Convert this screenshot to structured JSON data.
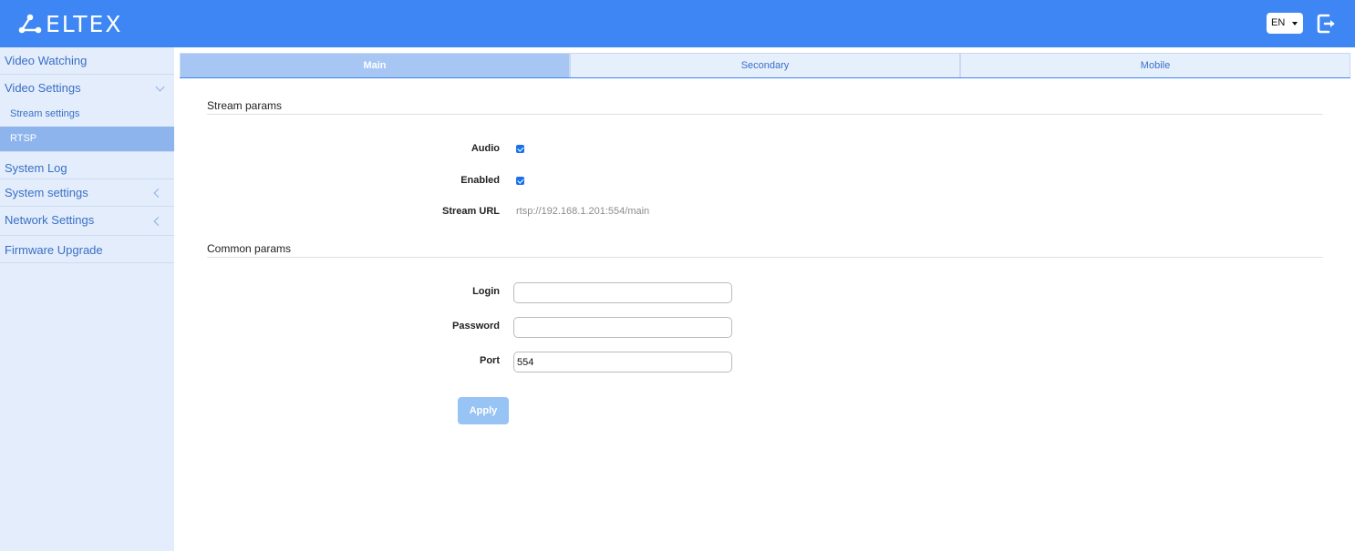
{
  "header": {
    "logo_text": "ELTEX",
    "language": "EN",
    "brand_color": "#3d86f4"
  },
  "sidebar": {
    "items": [
      {
        "label": "Video Watching"
      },
      {
        "label": "Video Settings",
        "icon": "chevron-down-icon"
      },
      {
        "label": "Stream settings"
      },
      {
        "label": "RTSP",
        "active": true
      },
      {
        "label": "System Log"
      },
      {
        "label": "System settings",
        "icon": "chevron-left-icon"
      },
      {
        "label": "Network Settings",
        "icon": "chevron-left-icon"
      },
      {
        "label": "Firmware Upgrade"
      }
    ]
  },
  "tabs": [
    {
      "label": "Main",
      "active": true
    },
    {
      "label": "Secondary"
    },
    {
      "label": "Mobile"
    }
  ],
  "stream_params": {
    "title": "Stream params",
    "audio_label": "Audio",
    "audio_checked": true,
    "enabled_label": "Enabled",
    "enabled_checked": true,
    "url_label": "Stream URL",
    "url_value": "rtsp://192.168.1.201:554/main"
  },
  "common_params": {
    "title": "Common params",
    "login_label": "Login",
    "login_value": "",
    "password_label": "Password",
    "password_value": "",
    "port_label": "Port",
    "port_value": "554"
  },
  "apply_label": "Apply"
}
